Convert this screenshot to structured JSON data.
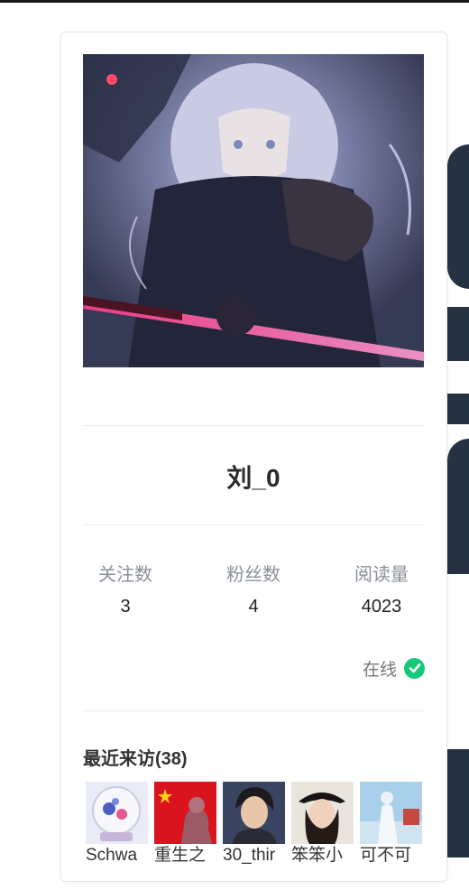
{
  "profile": {
    "username": "刘_0",
    "status": "在线"
  },
  "stats": [
    {
      "label": "关注数",
      "value": "3"
    },
    {
      "label": "粉丝数",
      "value": "4"
    },
    {
      "label": "阅读量",
      "value": "4023"
    }
  ],
  "recent": {
    "title": "最近来访(38)",
    "visitors": [
      {
        "name": "Schwa"
      },
      {
        "name": "重生之"
      },
      {
        "name": "30_thir"
      },
      {
        "name": "笨笨小"
      },
      {
        "name": "可不可"
      }
    ]
  },
  "colors": {
    "online": "#14c97a",
    "background_graphic": "#263241"
  },
  "icons": {
    "status": "check-circle-icon"
  }
}
